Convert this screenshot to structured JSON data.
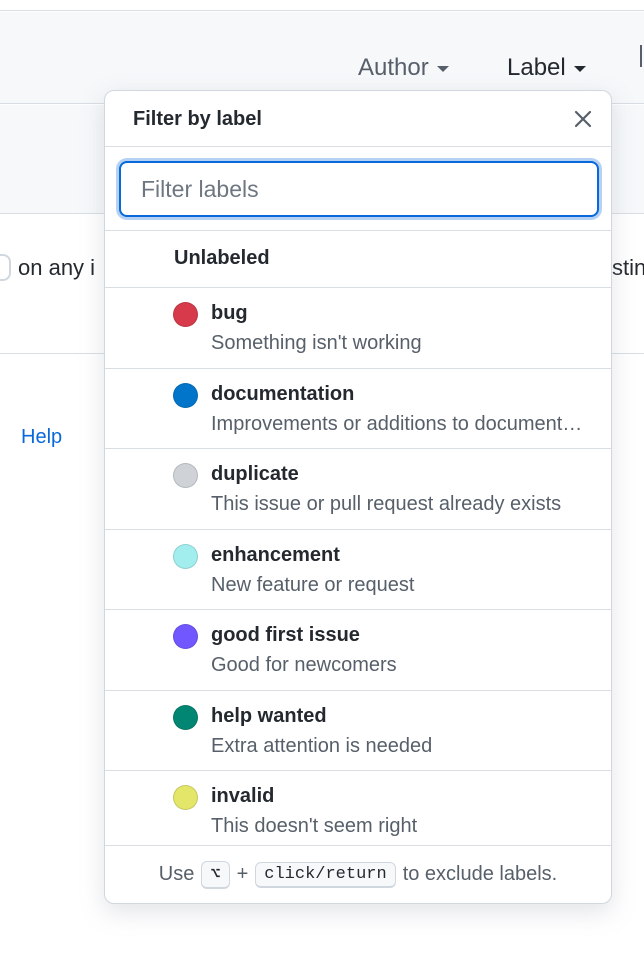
{
  "header": {
    "filters": [
      {
        "label": "Author"
      },
      {
        "label": "Label"
      }
    ]
  },
  "background": {
    "row_text": "on any i",
    "row_text_right": "stin",
    "help_link": "Help"
  },
  "popup": {
    "title": "Filter by label",
    "close_icon": "close-icon",
    "search": {
      "value": "",
      "placeholder": "Filter labels"
    },
    "unlabeled": "Unlabeled",
    "labels": [
      {
        "name": "bug",
        "description": "Something isn't working",
        "color": "#d73a4a"
      },
      {
        "name": "documentation",
        "description": "Improvements or additions to documentation",
        "color": "#0075ca"
      },
      {
        "name": "duplicate",
        "description": "This issue or pull request already exists",
        "color": "#cfd3d7"
      },
      {
        "name": "enhancement",
        "description": "New feature or request",
        "color": "#a2eeef"
      },
      {
        "name": "good first issue",
        "description": "Good for newcomers",
        "color": "#7057ff"
      },
      {
        "name": "help wanted",
        "description": "Extra attention is needed",
        "color": "#008672"
      },
      {
        "name": "invalid",
        "description": "This doesn't seem right",
        "color": "#e4e669"
      }
    ],
    "footer": {
      "prefix": "Use",
      "key1": "⌥",
      "plus": "+",
      "key2": "click/return",
      "suffix": "to exclude labels."
    }
  }
}
